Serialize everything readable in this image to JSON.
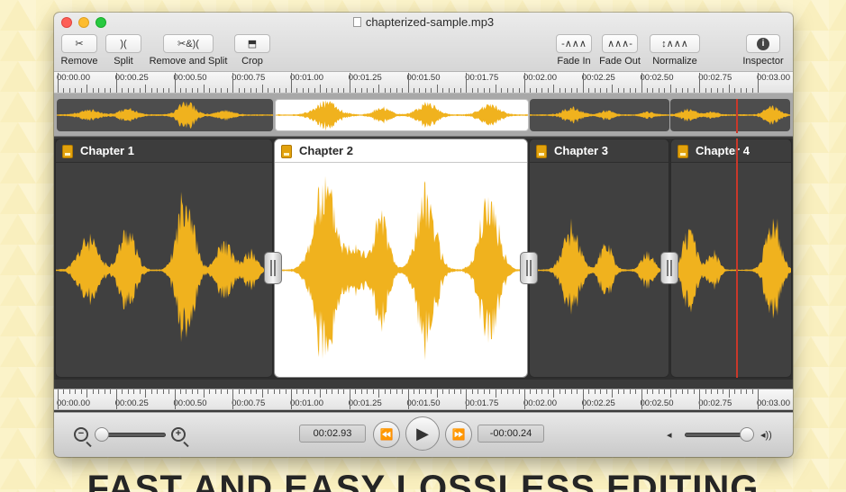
{
  "window": {
    "title": "chapterized-sample.mp3"
  },
  "toolbar": {
    "remove": {
      "label": "Remove",
      "glyph": "✂"
    },
    "split": {
      "label": "Split",
      "glyph": ")("
    },
    "remove_and_split": {
      "label": "Remove and Split",
      "glyph": "✂&)("
    },
    "crop": {
      "label": "Crop",
      "glyph": "⬒"
    },
    "fade_in": {
      "label": "Fade In",
      "glyph": "-∧∧∧"
    },
    "fade_out": {
      "label": "Fade Out",
      "glyph": "∧∧∧-"
    },
    "normalize": {
      "label": "Normalize",
      "glyph": "↕∧∧∧"
    },
    "inspector": {
      "label": "Inspector",
      "glyph": "i"
    }
  },
  "ruler": {
    "labels": [
      "00:00.00",
      "00:00.25",
      "00:00.50",
      "00:00.75",
      "00:01.00",
      "00:01.25",
      "00:01.50",
      "00:01.75",
      "00:02.00",
      "00:02.25",
      "00:02.50",
      "00:02.75",
      "00:03.00"
    ]
  },
  "chapters": [
    {
      "title": "Chapter 1",
      "selected": false
    },
    {
      "title": "Chapter 2",
      "selected": true
    },
    {
      "title": "Chapter 3",
      "selected": false
    },
    {
      "title": "Chapter 4",
      "selected": false
    }
  ],
  "waveform_color": "#f0b21e",
  "playhead_color": "#c9382a",
  "zoom_pill": {
    "minus": "−",
    "plus": "+"
  },
  "transport": {
    "current_time": "00:02.93",
    "remaining_time": "-00:00.24",
    "rewind_icon": "⏪",
    "play_icon": "▶",
    "forward_icon": "⏩",
    "zoom_out_glyph": "−",
    "zoom_in_glyph": "+",
    "volume_low_icon": "◂",
    "volume_high_icon": "◂))"
  },
  "headline": "FAST AND EASY LOSSLESS EDITING"
}
